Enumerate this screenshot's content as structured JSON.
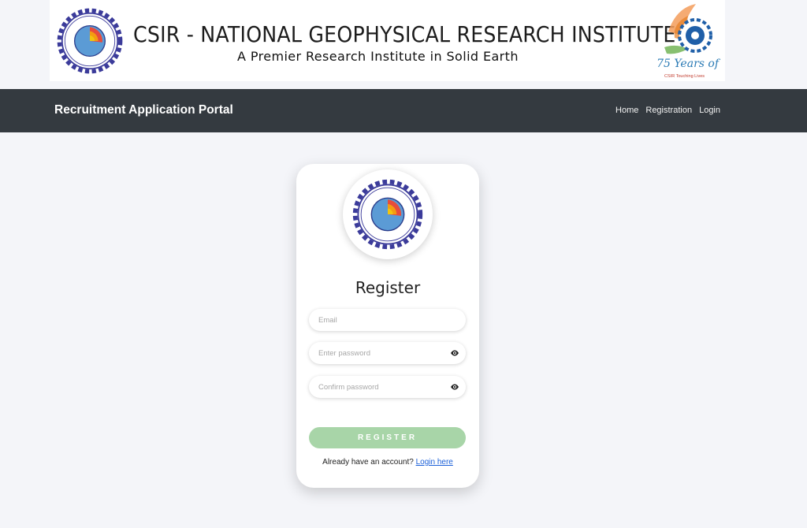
{
  "banner": {
    "title": "CSIR - NATIONAL GEOPHYSICAL RESEARCH INSTITUTE",
    "subtitle": "A Premier Research Institute in Solid Earth",
    "anniversary": "75 Years of",
    "anniversary_sub": "CSIR Touching Lives",
    "left_logo_icon": "ngri-emblem-icon",
    "right_logo_icon": "csir-75-years-logo-icon"
  },
  "navbar": {
    "brand": "Recruitment Application Portal",
    "links": [
      "Home",
      "Registration",
      "Login"
    ]
  },
  "form": {
    "heading": "Register",
    "email_placeholder": "Email",
    "password_placeholder": "Enter password",
    "confirm_placeholder": "Confirm password",
    "submit_label": "REGISTER",
    "login_prompt": "Already have an account?",
    "login_link": "Login here"
  },
  "colors": {
    "navbar_bg": "#343a40",
    "page_bg": "#f4f5f9",
    "button_bg": "#a8d5a8",
    "link": "#1a5fd8"
  }
}
